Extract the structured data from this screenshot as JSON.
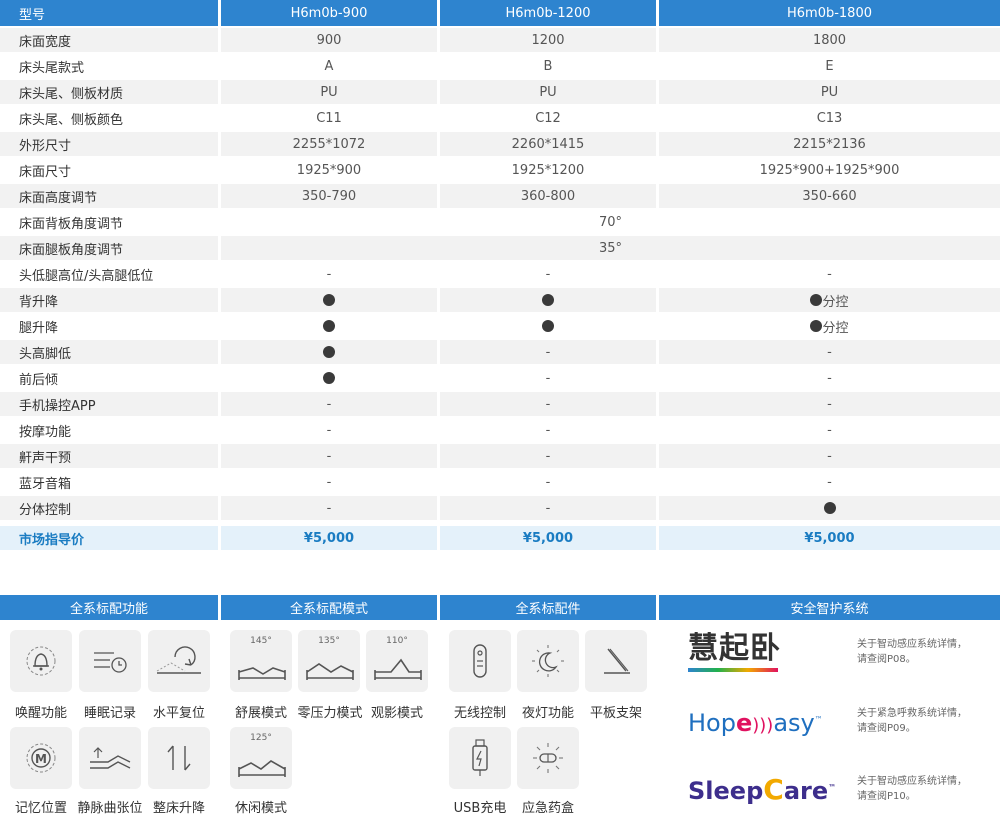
{
  "table": {
    "header": {
      "model": "型号",
      "m1": "H6m0b-900",
      "m2": "H6m0b-1200",
      "m3": "H6m0b-1800"
    },
    "rows": [
      {
        "label": "床面宽度",
        "v1": "900",
        "v2": "1200",
        "v3": "1800"
      },
      {
        "label": "床头尾款式",
        "v1": "A",
        "v2": "B",
        "v3": "E"
      },
      {
        "label": "床头尾、侧板材质",
        "v1": "PU",
        "v2": "PU",
        "v3": "PU"
      },
      {
        "label": "床头尾、侧板颜色",
        "v1": "C11",
        "v2": "C12",
        "v3": "C13"
      },
      {
        "label": "外形尺寸",
        "v1": "2255*1072",
        "v2": "2260*1415",
        "v3": "2215*2136"
      },
      {
        "label": "床面尺寸",
        "v1": "1925*900",
        "v2": "1925*1200",
        "v3": "1925*900+1925*900"
      },
      {
        "label": "床面高度调节",
        "v1": "350-790",
        "v2": "360-800",
        "v3": "350-660"
      },
      {
        "label": "床面背板角度调节",
        "span": "70°"
      },
      {
        "label": "床面腿板角度调节",
        "span": "35°"
      },
      {
        "label": "头低腿高位/头高腿低位",
        "v1": "-",
        "v2": "-",
        "v3": "-"
      },
      {
        "label": "背升降",
        "v1": "●",
        "v2": "●",
        "v3": "●分控"
      },
      {
        "label": "腿升降",
        "v1": "●",
        "v2": "●",
        "v3": "●分控"
      },
      {
        "label": "头高脚低",
        "v1": "●",
        "v2": "-",
        "v3": "-"
      },
      {
        "label": "前后倾",
        "v1": "●",
        "v2": "-",
        "v3": "-"
      },
      {
        "label": "手机操控APP",
        "v1": "-",
        "v2": "-",
        "v3": "-"
      },
      {
        "label": "按摩功能",
        "v1": "-",
        "v2": "-",
        "v3": "-"
      },
      {
        "label": "鼾声干预",
        "v1": "-",
        "v2": "-",
        "v3": "-"
      },
      {
        "label": "蓝牙音箱",
        "v1": "-",
        "v2": "-",
        "v3": "-"
      },
      {
        "label": "分体控制",
        "v1": "-",
        "v2": "-",
        "v3": "●"
      }
    ],
    "price": {
      "label": "市场指导价",
      "v1": "¥5,000",
      "v2": "¥5,000",
      "v3": "¥5,000"
    }
  },
  "panels": {
    "functions": {
      "title": "全系标配功能",
      "items": [
        {
          "label": "唤醒功能",
          "icon": "bell-icon"
        },
        {
          "label": "睡眠记录",
          "icon": "sleep-record-icon"
        },
        {
          "label": "水平复位",
          "icon": "level-reset-icon"
        },
        {
          "label": "记忆位置",
          "icon": "memory-icon"
        },
        {
          "label": "静脉曲张位",
          "icon": "varicose-position-icon"
        },
        {
          "label": "整床升降",
          "icon": "lift-icon"
        }
      ]
    },
    "modes": {
      "title": "全系标配模式",
      "items": [
        {
          "label": "舒展模式",
          "angle": "145°"
        },
        {
          "label": "零压力模式",
          "angle": "135°"
        },
        {
          "label": "观影模式",
          "angle": "110°"
        },
        {
          "label": "休闲模式",
          "angle": "125°"
        }
      ]
    },
    "accessories": {
      "title": "全系标配件",
      "items": [
        {
          "label": "无线控制",
          "icon": "remote-icon"
        },
        {
          "label": "夜灯功能",
          "icon": "night-light-icon"
        },
        {
          "label": "平板支架",
          "icon": "tablet-stand-icon"
        },
        {
          "label": "USB充电",
          "icon": "usb-icon"
        },
        {
          "label": "应急药盒",
          "icon": "pill-box-icon"
        }
      ]
    },
    "safety": {
      "title": "安全智护系统",
      "brands": [
        {
          "logo": "慧起卧",
          "note1": "关于智动感应系统详情，",
          "note2": "请查阅P08。"
        },
        {
          "logo_pre": "Hop",
          "logo_mid": "e",
          "logo_post": "asy",
          "tm": "™",
          "note1": "关于紧急呼救系统详情，",
          "note2": "请查阅P09。"
        },
        {
          "logo_pre": "Sleep",
          "logo_mid": "C",
          "logo_post": "are",
          "tm": "™",
          "note1": "关于智动感应系统详情，",
          "note2": "请查阅P10。"
        }
      ]
    }
  },
  "colors": {
    "header_blue": "#2e84cf",
    "price_text": "#1a7cc2",
    "price_bg": "#e4f1fa",
    "row_alt": "#f2f2f2"
  }
}
